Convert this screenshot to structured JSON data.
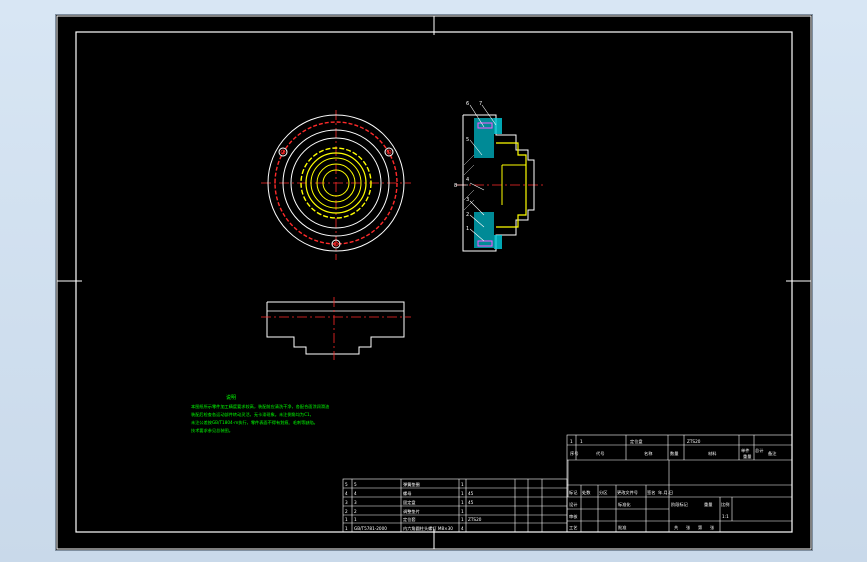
{
  "notes": {
    "heading": "说明",
    "lines": [
      "本图纸所示零件加工精度要求较高，装配前应清洗干净，各配合面涂润滑油",
      "装配后检查各运动部件转动灵活，无卡滞现象。未注倒角均为C1，",
      "未注公差按GB/T1804-m执行，零件表面不得有划痕、毛刺等缺陷。",
      "技术要求参见总装图。"
    ]
  },
  "section_balloons": [
    "6",
    "7",
    "5",
    "4",
    "3",
    "2",
    "1",
    "8"
  ],
  "title_block": {
    "header_row": {
      "index": "1",
      "qty": "1",
      "name": "定位盘",
      "material": "ZTS20"
    },
    "col_headers": [
      "序号",
      "代号",
      "名称",
      "数量",
      "材料",
      "单件",
      "总计",
      "备注"
    ],
    "weight_label": "重量",
    "sign_row": [
      "标记",
      "处数",
      "分区",
      "更改文件号",
      "签名",
      "年.月.日"
    ],
    "design_row": [
      "设计",
      "",
      "标准化"
    ],
    "check_row": [
      "审核",
      ""
    ],
    "process_row": [
      "工艺",
      "",
      "批准"
    ],
    "stage_labels": [
      "阶段标记",
      "重量",
      "比例"
    ],
    "sheet_labels": [
      "共",
      "张",
      "第",
      "张"
    ],
    "scale_value": "1:1"
  },
  "parts_list": {
    "rows": [
      {
        "no": "5",
        "code": "5",
        "name": "弹簧垫圈",
        "qty": "1",
        "material": ""
      },
      {
        "no": "4",
        "code": "4",
        "name": "螺母",
        "qty": "1",
        "material": "45"
      },
      {
        "no": "3",
        "code": "3",
        "name": "固定盘",
        "qty": "1",
        "material": "45"
      },
      {
        "no": "2",
        "code": "2",
        "name": "调整垫片",
        "qty": "1",
        "material": ""
      },
      {
        "no": "1",
        "code": "1",
        "name": "定位套",
        "qty": "1",
        "material": "ZTS20"
      },
      {
        "no": "1",
        "code": "GB/T5781-2000",
        "name": "内六角圆柱头螺钉 M8×30",
        "qty": "4",
        "material": ""
      }
    ]
  },
  "colors": {
    "frame": "#ffffff",
    "center": "#ff2a2a",
    "yellow": "#ffff00",
    "cyan": "#00ffff",
    "green": "#00ff00",
    "magenta": "#ff55ff"
  }
}
